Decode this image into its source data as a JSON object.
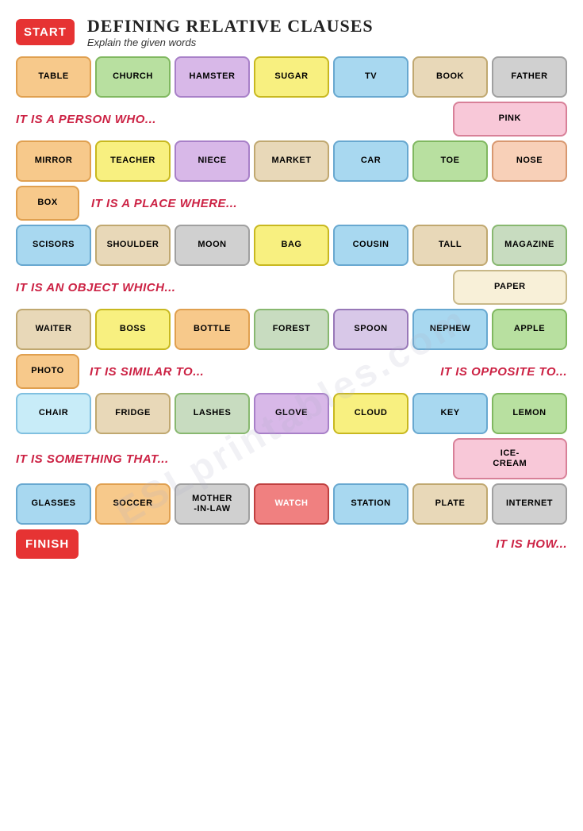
{
  "title": "DEFINING RELATIVE CLAUSES",
  "subtitle": "Explain the given words",
  "start_label": "START",
  "finish_label": "FINISH",
  "hints": {
    "person": "IT IS A PERSON WHO...",
    "place": "IT IS A PLACE WHERE...",
    "object": "IT IS AN OBJECT WHICH...",
    "similar": "IT IS SIMILAR TO...",
    "opposite": "IT IS OPPOSITE TO...",
    "something": "IT IS SOMETHING THAT...",
    "how": "IT IS HOW..."
  },
  "row1": [
    "TABLE",
    "CHURCH",
    "HAMSTER",
    "SUGAR",
    "TV",
    "BOOK",
    "FATHER"
  ],
  "row2_right": "PINK",
  "row3": [
    "MIRROR",
    "TEACHER",
    "NIECE",
    "MARKET",
    "CAR",
    "TOE",
    "NOSE"
  ],
  "row4_left": "BOX",
  "row5": [
    "SCISORS",
    "SHOULDER",
    "MOON",
    "BAG",
    "COUSIN",
    "TALL",
    "MAGAZINE"
  ],
  "row6_right": "PAPER",
  "row7": [
    "WAITER",
    "BOSS",
    "BOTTLE",
    "FOREST",
    "SPOON",
    "NEPHEW",
    "APPLE"
  ],
  "row8_left": "PHOTO",
  "row9": [
    "CHAIR",
    "FRIDGE",
    "LASHES",
    "GLOVE",
    "CLOUD",
    "KEY",
    "LEMON"
  ],
  "row10_right": "ICE-\nCREAM",
  "row11": [
    "GLASSES",
    "SOCCER",
    "MOTHER\n-IN-LAW",
    "WATCH",
    "STATION",
    "PLATE",
    "INTERNET"
  ]
}
